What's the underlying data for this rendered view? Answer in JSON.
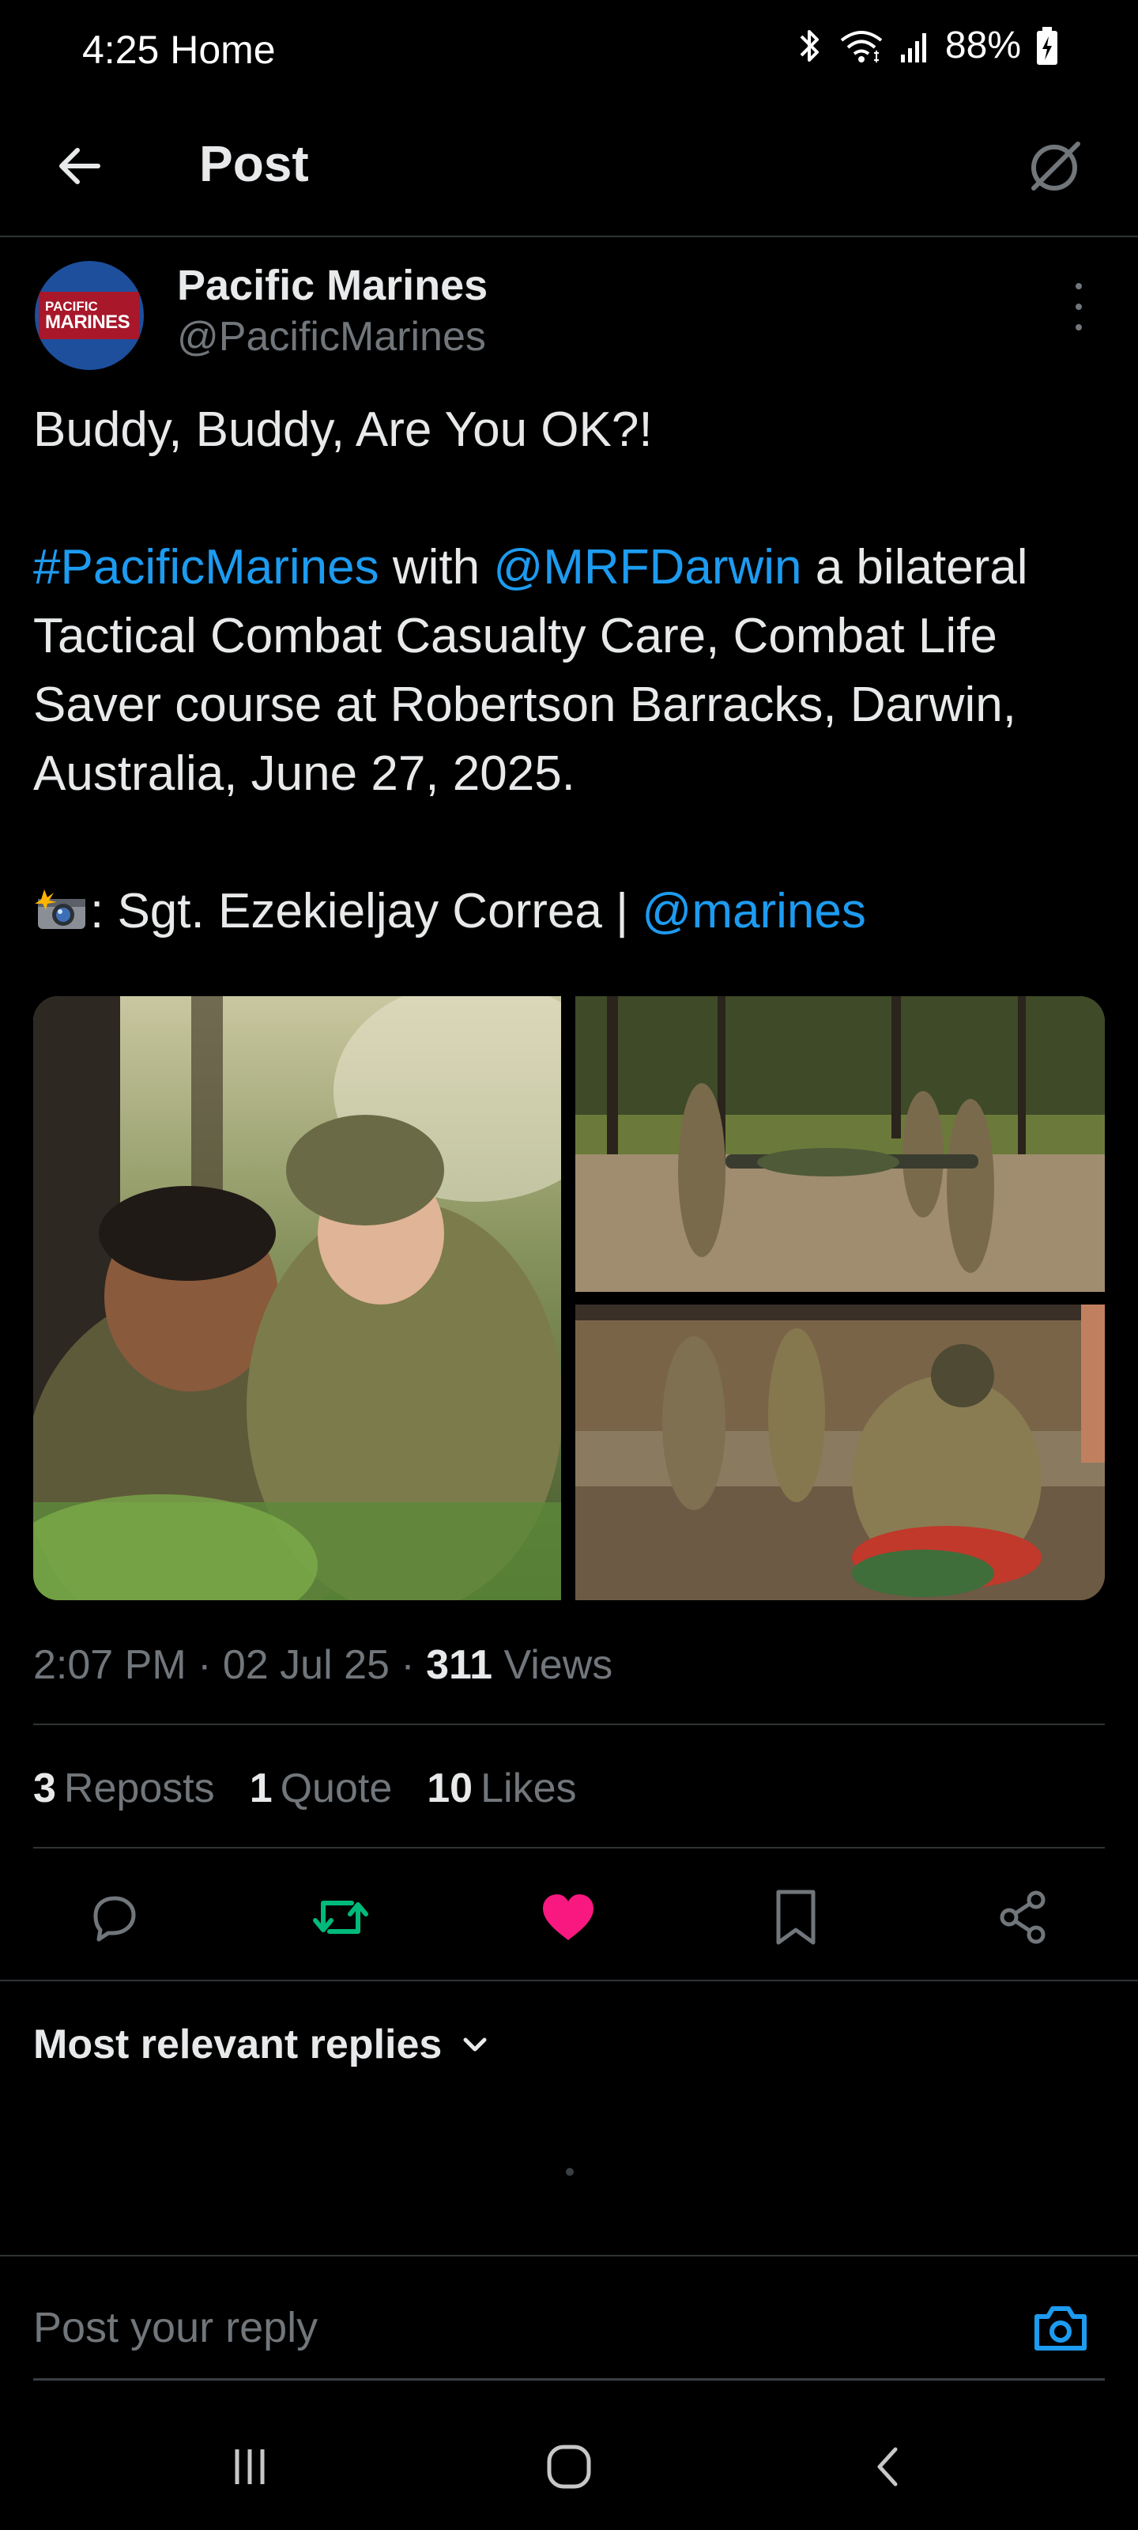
{
  "status_bar": {
    "time": "4:25 Home",
    "battery": "88%"
  },
  "header": {
    "title": "Post"
  },
  "author": {
    "name": "Pacific Marines",
    "handle": "@PacificMarines",
    "avatar_line1": "PACIFIC",
    "avatar_line2": "MARINES"
  },
  "tweet": {
    "line1": "Buddy, Buddy, Are You OK?!",
    "hashtag": "#PacificMarines",
    "with_text": " with ",
    "mention": "@MRFDarwin",
    "body_rest": " a bilateral Tactical Combat Casualty Care, Combat Life Saver course at Robertson Barracks, Darwin, Australia, June 27, 2025.",
    "credit_text": ": Sgt. Ezekieljay Correa | ",
    "credit_mention": "@marines"
  },
  "meta": {
    "time": "2:07 PM",
    "sep1": " · ",
    "date": "02 Jul 25",
    "sep2": " · ",
    "views_count": "311",
    "views_label": " Views"
  },
  "stats": {
    "reposts_count": "3",
    "reposts_label": "Reposts",
    "quotes_count": "1",
    "quotes_label": "Quote",
    "likes_count": "10",
    "likes_label": "Likes"
  },
  "actions": {
    "retweet_color": "#00ba7c",
    "like_color": "#f91880"
  },
  "replies": {
    "sort_label": "Most relevant replies"
  },
  "reply_box": {
    "placeholder": "Post your reply"
  },
  "colors": {
    "accent": "#1d9bf0",
    "background": "#000000",
    "text": "#e7e9ea",
    "muted": "#71767b"
  }
}
